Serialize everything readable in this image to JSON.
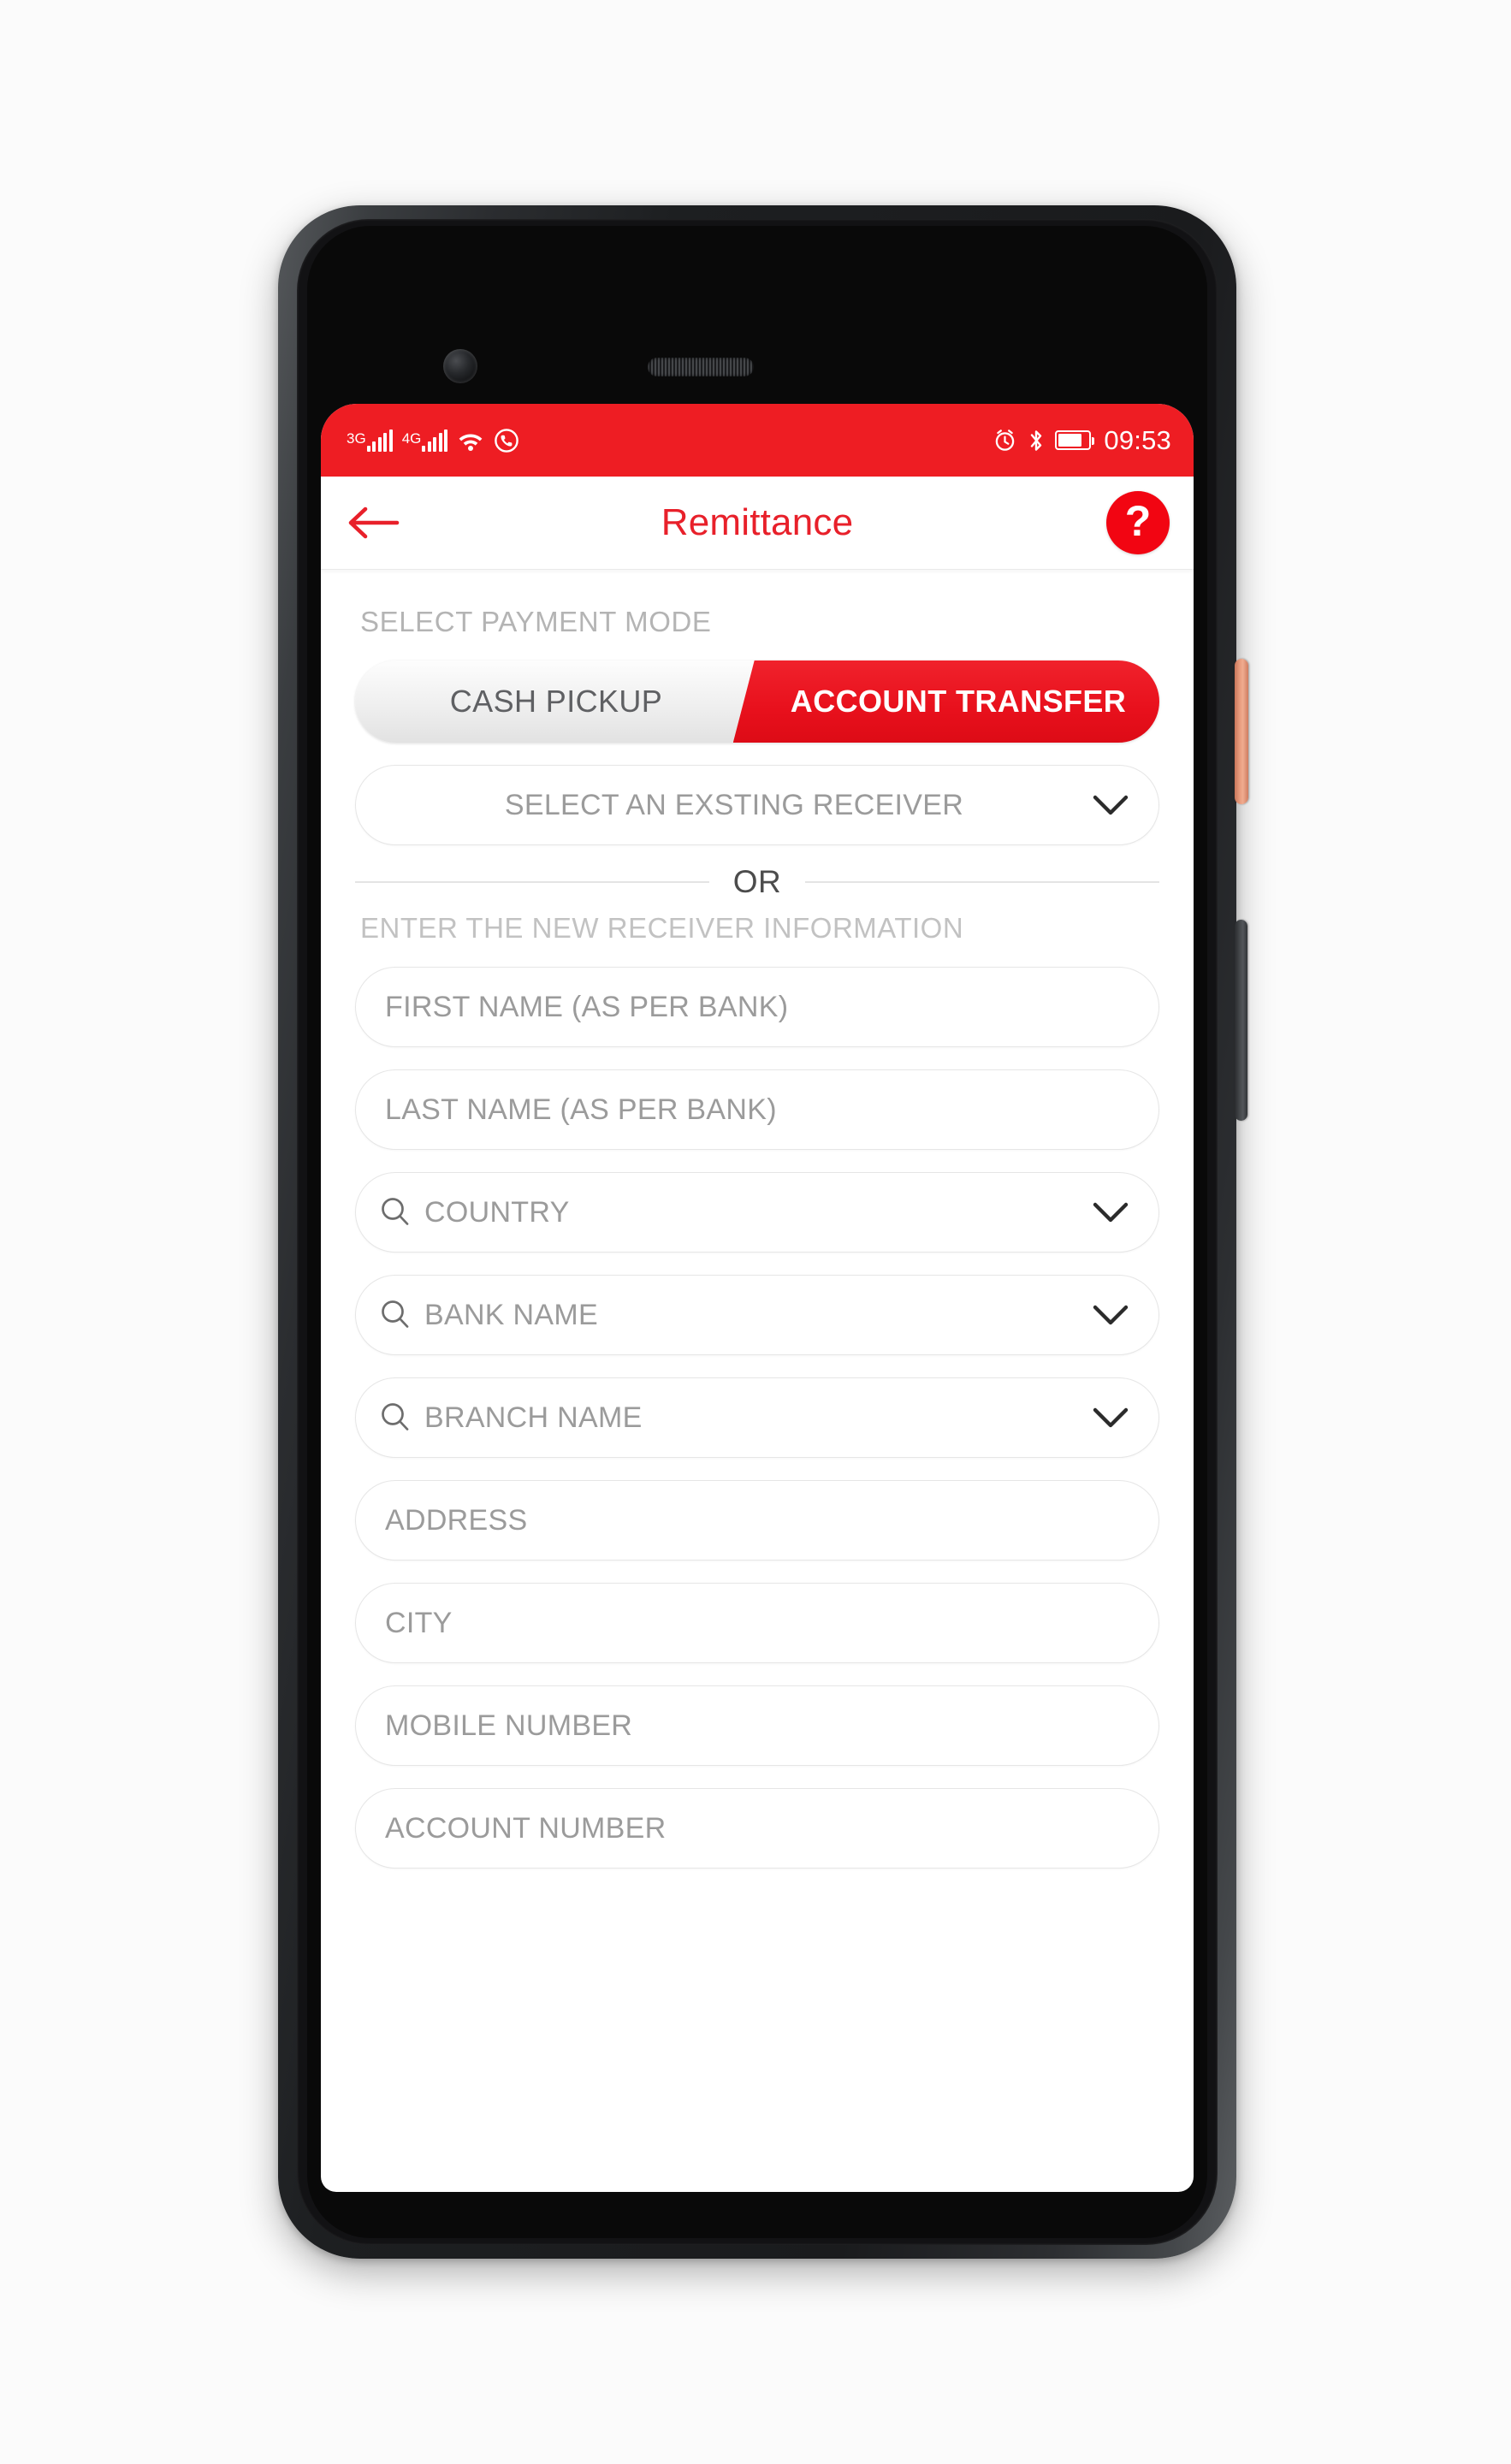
{
  "status_bar": {
    "network_3g_label": "3G",
    "network_4g_label": "4G",
    "wifi_icon": "wifi-icon",
    "call_icon": "call-icon",
    "alarm_icon": "alarm-icon",
    "bluetooth_icon": "bluetooth-icon",
    "battery_icon": "battery-icon",
    "time": "09:53"
  },
  "app_bar": {
    "back_icon": "back-arrow-icon",
    "title": "Remittance",
    "help_label": "?"
  },
  "payment_mode": {
    "section_label": "SELECT PAYMENT MODE",
    "options": [
      {
        "label": "CASH PICKUP",
        "active": false
      },
      {
        "label": "ACCOUNT TRANSFER",
        "active": true
      }
    ],
    "active_color": "#ee1d23",
    "inactive_color": "#ececec"
  },
  "receiver": {
    "existing_selector": {
      "label": "SELECT AN EXSTING RECEIVER",
      "chevron_icon": "chevron-down-icon"
    },
    "divider_text": "OR",
    "new_receiver_label": "ENTER THE NEW RECEIVER INFORMATION",
    "fields": [
      {
        "placeholder": "FIRST NAME (AS PER BANK)",
        "value": "",
        "search": false,
        "chevron": false,
        "name": "first-name-field"
      },
      {
        "placeholder": "LAST NAME (AS PER BANK)",
        "value": "",
        "search": false,
        "chevron": false,
        "name": "last-name-field"
      },
      {
        "placeholder": "COUNTRY",
        "value": "",
        "search": true,
        "chevron": true,
        "name": "country-field"
      },
      {
        "placeholder": "BANK NAME",
        "value": "",
        "search": true,
        "chevron": true,
        "name": "bank-name-field"
      },
      {
        "placeholder": "BRANCH NAME",
        "value": "",
        "search": true,
        "chevron": true,
        "name": "branch-name-field"
      },
      {
        "placeholder": "ADDRESS",
        "value": "",
        "search": false,
        "chevron": false,
        "name": "address-field"
      },
      {
        "placeholder": "CITY",
        "value": "",
        "search": false,
        "chevron": false,
        "name": "city-field"
      },
      {
        "placeholder": "MOBILE NUMBER",
        "value": "",
        "search": false,
        "chevron": false,
        "name": "mobile-number-field"
      },
      {
        "placeholder": "ACCOUNT NUMBER",
        "value": "",
        "search": false,
        "chevron": false,
        "name": "account-number-field"
      }
    ]
  },
  "device": {
    "power_button": "power-button",
    "volume_button": "volume-rocker",
    "front_camera": "front-camera",
    "earpiece": "earpiece-speaker"
  }
}
